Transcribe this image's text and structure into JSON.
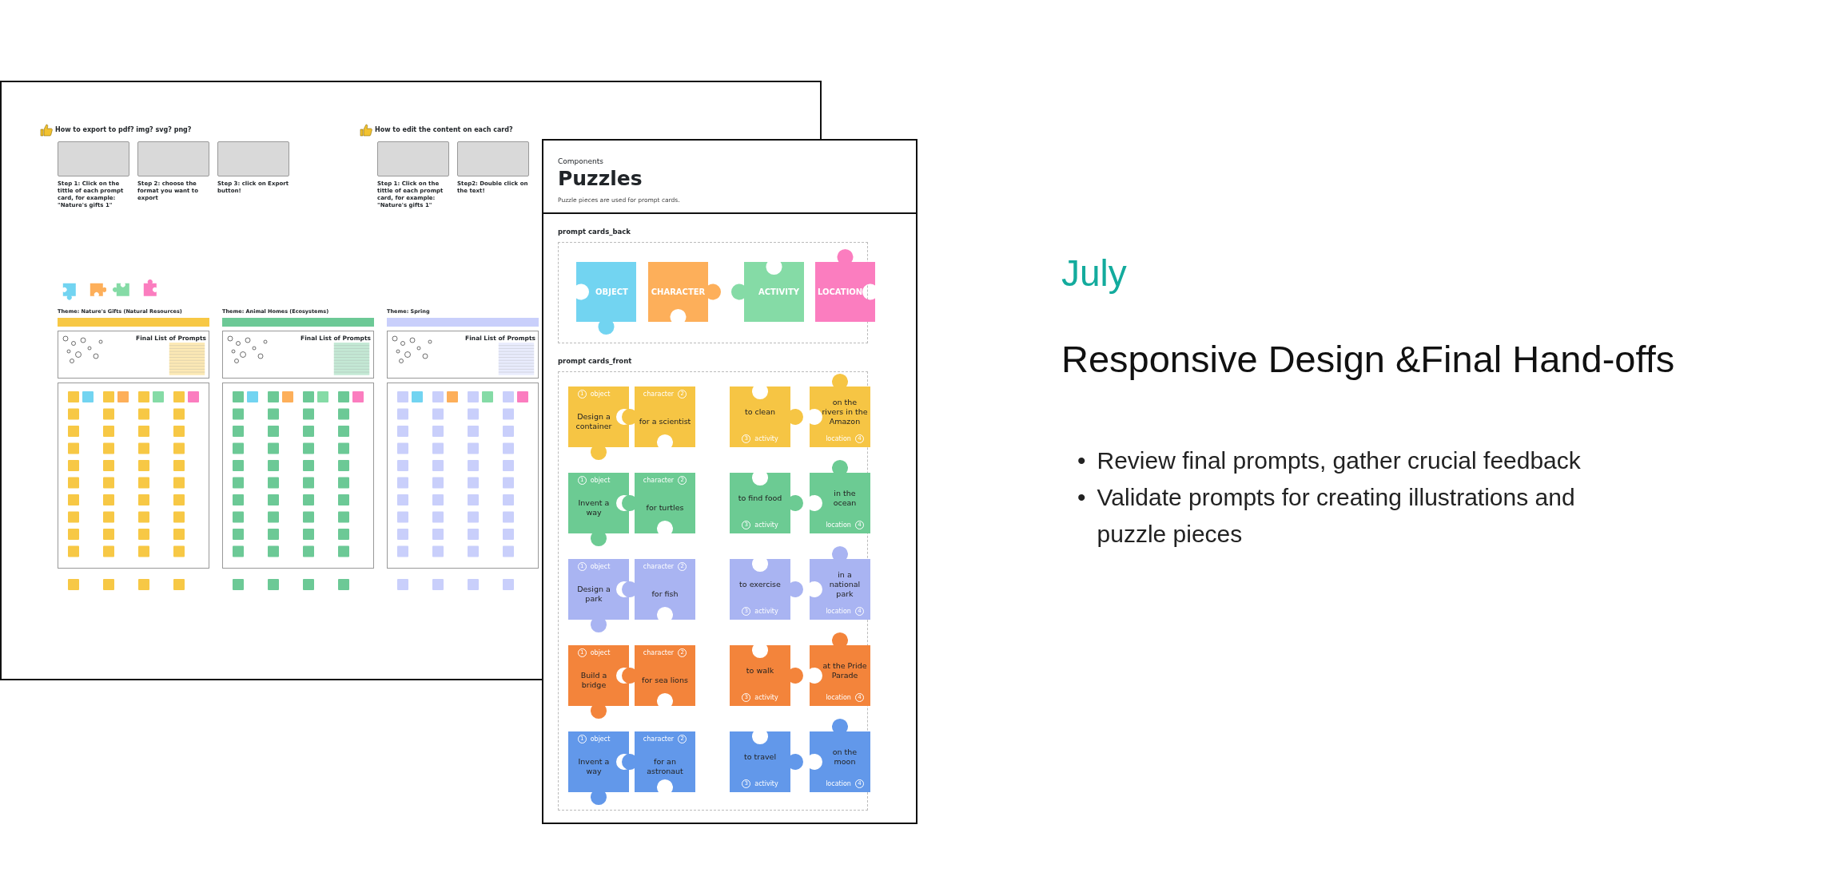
{
  "board": {
    "help": [
      {
        "title": "How to export to pdf? img? svg? png?",
        "steps": [
          "Step 1: Click on the tittle of each prompt card, for example: \"Nature's gifts 1\"",
          "Step 2: choose the format you want to export",
          "Step 3: click on Export button!"
        ]
      },
      {
        "title": "How to edit the content on each card?",
        "steps": [
          "Step 1: Click on the tittle of each prompt card, for example: \"Nature's gifts 1\"",
          "Step2: Double click on the text!"
        ]
      }
    ],
    "legend": [
      {
        "color": "#72d4f1"
      },
      {
        "color": "#fdaf5a"
      },
      {
        "color": "#85dba6"
      },
      {
        "color": "#fb7dbf"
      }
    ],
    "themes": [
      {
        "title": "Theme: Nature's Gifts (Natural Resources)",
        "color": "#f7c845",
        "table_title": "Final List of Prompts"
      },
      {
        "title": "Theme: Animal Homes (Ecosystems)",
        "color": "#6cc996",
        "table_title": "Final List of Prompts"
      },
      {
        "title": "Theme: Spring",
        "color": "#c9cffb",
        "table_title": "Final List of Prompts"
      }
    ]
  },
  "components": {
    "eyebrow": "Components",
    "title": "Puzzles",
    "description": "Puzzle pieces are used for prompt cards.",
    "back": {
      "label": "prompt cards_back",
      "cards": [
        {
          "text": "OBJECT",
          "color": "#72d4f1"
        },
        {
          "text": "CHARACTER",
          "color": "#fdaf5a"
        },
        {
          "text": "ACTIVITY",
          "color": "#85dba6"
        },
        {
          "text": "LOCATION",
          "color": "#fb7dbf"
        }
      ]
    },
    "front": {
      "label": "prompt cards_front",
      "rows": [
        {
          "color": "#f6c544",
          "cards": [
            {
              "tag": "object",
              "num": "1",
              "text": "Design a container"
            },
            {
              "tag": "character",
              "num": "2",
              "text": "for a scientist"
            },
            {
              "tag": "activity",
              "num": "3",
              "text": "to clean"
            },
            {
              "tag": "location",
              "num": "4",
              "text": "on the rivers in the Amazon"
            }
          ]
        },
        {
          "color": "#6ccb93",
          "cards": [
            {
              "tag": "object",
              "num": "1",
              "text": "Invent a way"
            },
            {
              "tag": "character",
              "num": "2",
              "text": "for turtles"
            },
            {
              "tag": "activity",
              "num": "3",
              "text": "to find food"
            },
            {
              "tag": "location",
              "num": "4",
              "text": "in the ocean"
            }
          ]
        },
        {
          "color": "#a9b4f2",
          "cards": [
            {
              "tag": "object",
              "num": "1",
              "text": "Design a park"
            },
            {
              "tag": "character",
              "num": "2",
              "text": "for fish"
            },
            {
              "tag": "activity",
              "num": "3",
              "text": "to exercise"
            },
            {
              "tag": "location",
              "num": "4",
              "text": "in a national park"
            }
          ]
        },
        {
          "color": "#f3843b",
          "cards": [
            {
              "tag": "object",
              "num": "1",
              "text": "Build a bridge"
            },
            {
              "tag": "character",
              "num": "2",
              "text": "for sea lions"
            },
            {
              "tag": "activity",
              "num": "3",
              "text": "to walk"
            },
            {
              "tag": "location",
              "num": "4",
              "text": "at the Pride Parade"
            }
          ]
        },
        {
          "color": "#6298ea",
          "cards": [
            {
              "tag": "object",
              "num": "1",
              "text": "Invent a way"
            },
            {
              "tag": "character",
              "num": "2",
              "text": "for an astronaut"
            },
            {
              "tag": "activity",
              "num": "3",
              "text": "to travel"
            },
            {
              "tag": "location",
              "num": "4",
              "text": "on the moon"
            }
          ]
        }
      ]
    }
  },
  "slide": {
    "month": "July",
    "title": "Responsive Design &Final Hand-offs",
    "bullets": [
      {
        "marker": "•",
        "text": "Review final prompts, gather crucial feedback"
      },
      {
        "marker": "•",
        "text": "Validate prompts for creating illustrations and puzzle pieces"
      }
    ]
  }
}
